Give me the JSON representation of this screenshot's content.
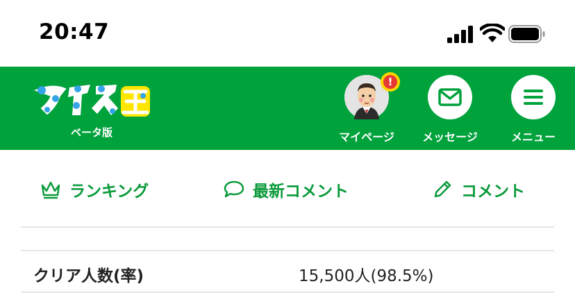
{
  "status_bar": {
    "time": "20:47"
  },
  "header": {
    "logo_text": "マイネ王",
    "logo_sub": "ベータ版",
    "mypage_label": "マイページ",
    "mypage_badge": "!",
    "message_label": "メッセージ",
    "menu_label": "メニュー",
    "brand_color": "#00a23c"
  },
  "nav": {
    "ranking": "ランキング",
    "latest_comments": "最新コメント",
    "comment": "コメント",
    "accent_color": "#0a9a3a"
  },
  "table": {
    "rows": [
      {
        "label": "クリア人数(率)",
        "value": "15,500人(98.5%)"
      }
    ]
  }
}
